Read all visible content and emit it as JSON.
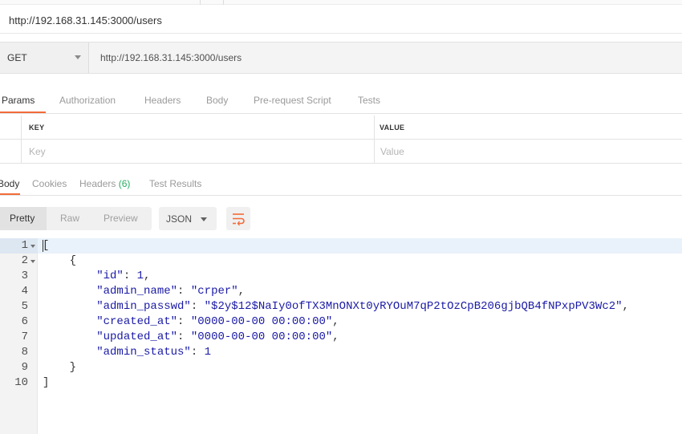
{
  "tab": {
    "title": "http://192.168.31.145:3000/users"
  },
  "request": {
    "method": "GET",
    "url": "http://192.168.31.145:3000/users"
  },
  "request_tabs": [
    {
      "label": "Params",
      "active": true
    },
    {
      "label": "Authorization"
    },
    {
      "label": "Headers"
    },
    {
      "label": "Body"
    },
    {
      "label": "Pre-request Script"
    },
    {
      "label": "Tests"
    }
  ],
  "params_table": {
    "key_header": "KEY",
    "value_header": "VALUE",
    "key_placeholder": "Key",
    "value_placeholder": "Value"
  },
  "response_tabs": [
    {
      "label": "Body",
      "active": true
    },
    {
      "label": "Cookies"
    },
    {
      "label": "Headers",
      "count": "(6)"
    },
    {
      "label": "Test Results"
    }
  ],
  "view_modes": [
    {
      "label": "Pretty",
      "active": true
    },
    {
      "label": "Raw"
    },
    {
      "label": "Preview"
    }
  ],
  "format": {
    "selected": "JSON"
  },
  "icons": {
    "method_dropdown": "chevron-down-icon",
    "format_dropdown": "chevron-down-icon",
    "wrap": "wrap-lines-icon"
  },
  "colors": {
    "accent": "#f26b3a",
    "json_value": "#1a1aa6",
    "badge": "#27ae60"
  },
  "editor": {
    "line_numbers": [
      "1",
      "2",
      "3",
      "4",
      "5",
      "6",
      "7",
      "8",
      "9",
      "10"
    ],
    "lines": [
      {
        "indent": "",
        "text": "["
      },
      {
        "indent": "    ",
        "text": "{"
      },
      {
        "indent": "        ",
        "key": "\"id\"",
        "sep": ": ",
        "value": "1",
        "end": ","
      },
      {
        "indent": "        ",
        "key": "\"admin_name\"",
        "sep": ": ",
        "value": "\"crper\"",
        "end": ","
      },
      {
        "indent": "        ",
        "key": "\"admin_passwd\"",
        "sep": ": ",
        "value": "\"$2y$12$NaIy0ofTX3MnONXt0yRYOuM7qP2tOzCpB206gjbQB4fNPxpPV3Wc2\"",
        "end": ","
      },
      {
        "indent": "        ",
        "key": "\"created_at\"",
        "sep": ": ",
        "value": "\"0000-00-00 00:00:00\"",
        "end": ","
      },
      {
        "indent": "        ",
        "key": "\"updated_at\"",
        "sep": ": ",
        "value": "\"0000-00-00 00:00:00\"",
        "end": ","
      },
      {
        "indent": "        ",
        "key": "\"admin_status\"",
        "sep": ": ",
        "value": "1",
        "end": ""
      },
      {
        "indent": "    ",
        "text": "}"
      },
      {
        "indent": "",
        "text": "]"
      }
    ]
  }
}
